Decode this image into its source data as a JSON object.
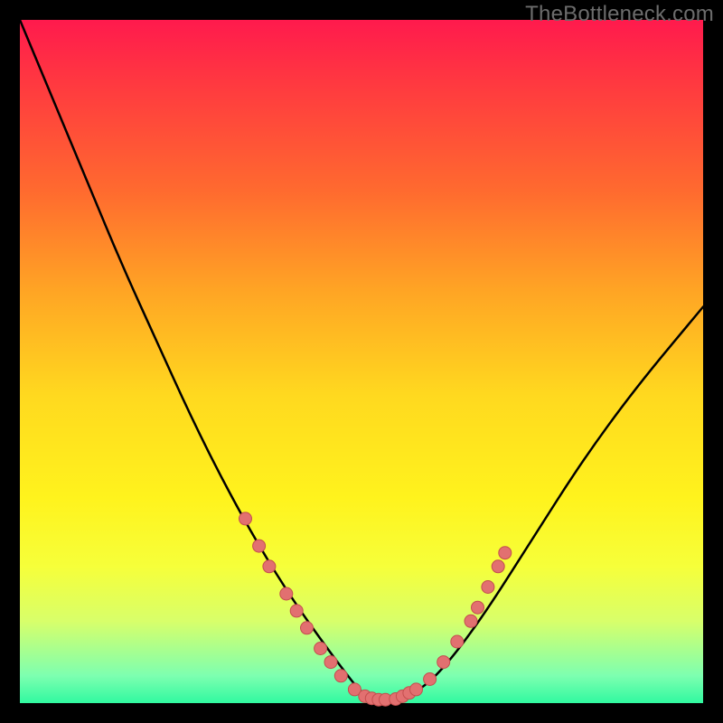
{
  "watermark": "TheBottleneck.com",
  "chart_data": {
    "type": "line",
    "title": "",
    "xlabel": "",
    "ylabel": "",
    "xlim": [
      0,
      100
    ],
    "ylim": [
      0,
      100
    ],
    "series": [
      {
        "name": "bottleneck-curve",
        "x": [
          0,
          5,
          10,
          15,
          20,
          25,
          30,
          35,
          40,
          45,
          48,
          50,
          52,
          55,
          58,
          62,
          68,
          75,
          82,
          90,
          100
        ],
        "y": [
          100,
          88,
          76,
          64,
          53,
          42,
          32,
          23,
          15,
          8,
          4,
          1.5,
          0.5,
          0.5,
          1.5,
          5,
          13,
          24,
          35,
          46,
          58
        ]
      }
    ],
    "markers": {
      "name": "highlight-points",
      "points": [
        {
          "x": 33,
          "y": 27
        },
        {
          "x": 35,
          "y": 23
        },
        {
          "x": 36.5,
          "y": 20
        },
        {
          "x": 39,
          "y": 16
        },
        {
          "x": 40.5,
          "y": 13.5
        },
        {
          "x": 42,
          "y": 11
        },
        {
          "x": 44,
          "y": 8
        },
        {
          "x": 45.5,
          "y": 6
        },
        {
          "x": 47,
          "y": 4
        },
        {
          "x": 49,
          "y": 2
        },
        {
          "x": 50.5,
          "y": 1
        },
        {
          "x": 51.5,
          "y": 0.7
        },
        {
          "x": 52.5,
          "y": 0.5
        },
        {
          "x": 53.5,
          "y": 0.5
        },
        {
          "x": 55,
          "y": 0.6
        },
        {
          "x": 56,
          "y": 1
        },
        {
          "x": 57,
          "y": 1.5
        },
        {
          "x": 58,
          "y": 2
        },
        {
          "x": 60,
          "y": 3.5
        },
        {
          "x": 62,
          "y": 6
        },
        {
          "x": 64,
          "y": 9
        },
        {
          "x": 66,
          "y": 12
        },
        {
          "x": 67,
          "y": 14
        },
        {
          "x": 68.5,
          "y": 17
        },
        {
          "x": 70,
          "y": 20
        },
        {
          "x": 71,
          "y": 22
        }
      ]
    },
    "background_gradient": {
      "top": "#ff1a4d",
      "mid": "#ffd91f",
      "bottom": "#30f9a0"
    }
  }
}
